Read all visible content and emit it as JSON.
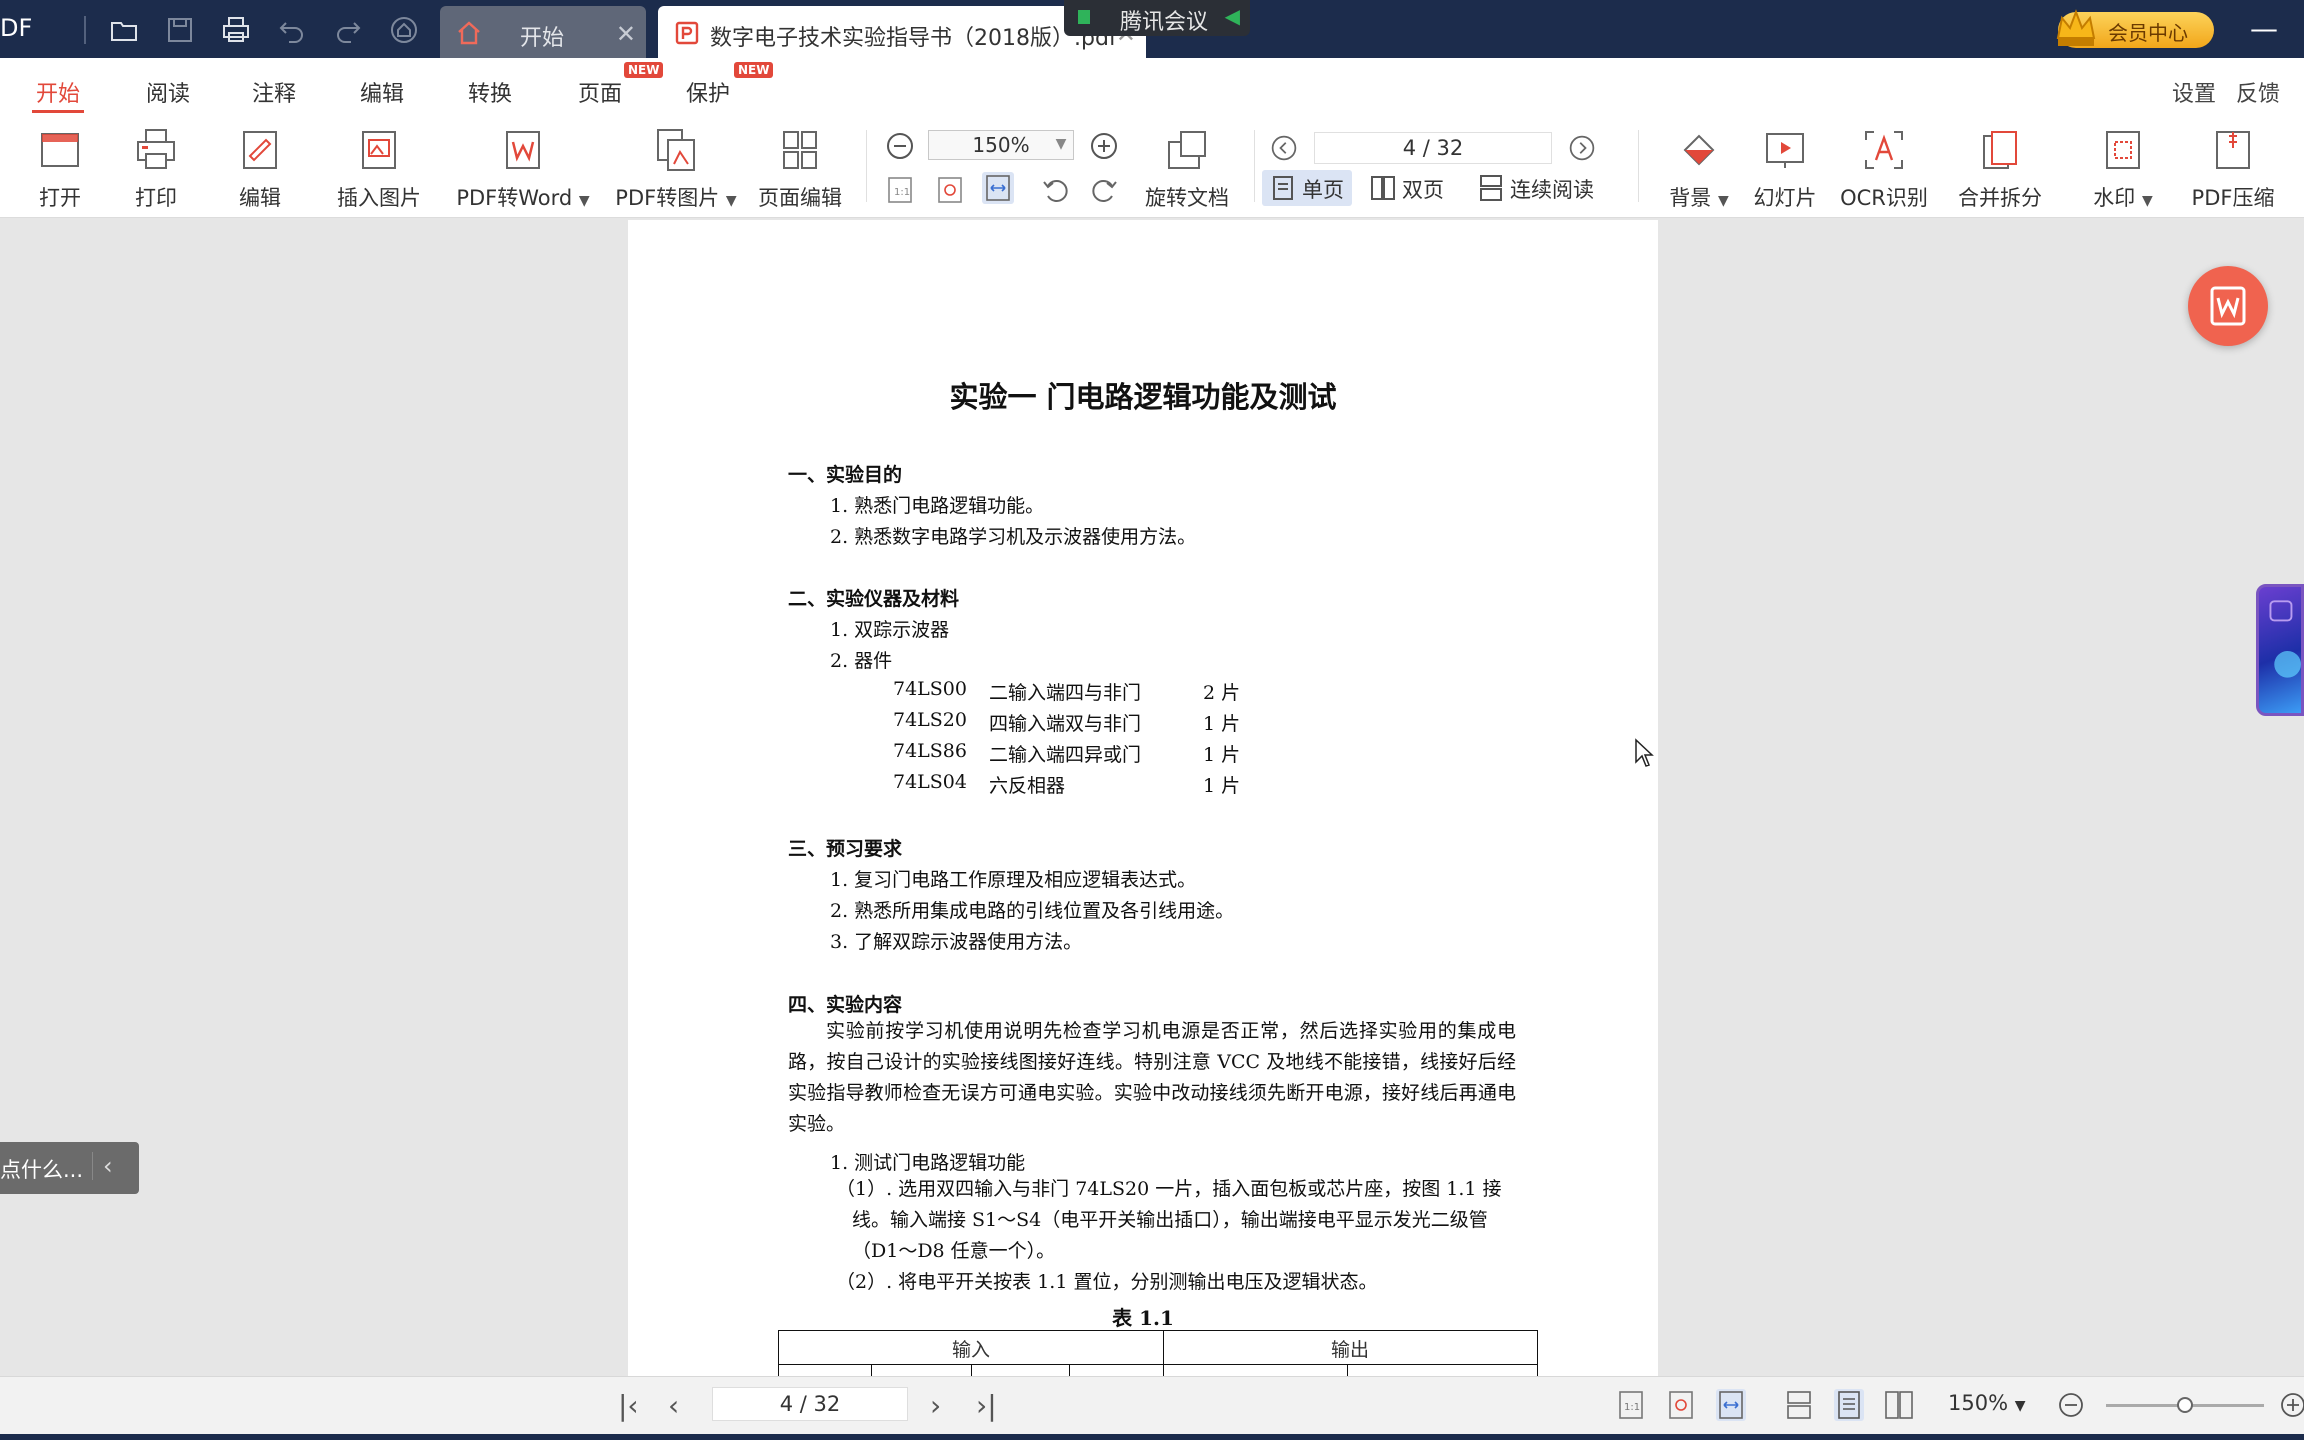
{
  "titlebar": {
    "app_fragment": "DF",
    "tabs": [
      {
        "label": "开始"
      },
      {
        "label": "数字电子技术实验指导书（2018版）.pdf"
      }
    ],
    "meeting_label": "腾讯会议",
    "vip_label": "会员中心",
    "minimize": "—"
  },
  "menu": {
    "items": [
      {
        "label": "开始",
        "active": true
      },
      {
        "label": "阅读"
      },
      {
        "label": "注释"
      },
      {
        "label": "编辑"
      },
      {
        "label": "转换"
      },
      {
        "label": "页面",
        "badge": "NEW"
      },
      {
        "label": "保护",
        "badge": "NEW"
      }
    ],
    "right": [
      "设置",
      "反馈"
    ]
  },
  "toolbar": {
    "open": "打开",
    "print": "打印",
    "edit": "编辑",
    "insert_image": "插入图片",
    "pdf_to_word": "PDF转Word",
    "pdf_to_image": "PDF转图片",
    "page_edit": "页面编辑",
    "zoom": "150%",
    "rotate_doc": "旋转文档",
    "page_indicator": "4 / 32",
    "single": "单页",
    "double": "双页",
    "continuous": "连续阅读",
    "background": "背景",
    "slideshow": "幻灯片",
    "ocr": "OCR识别",
    "merge_split": "合并拆分",
    "watermark": "水印",
    "compress": "PDF压缩"
  },
  "document": {
    "title": "实验一  门电路逻辑功能及测试",
    "s1": {
      "heading": "一、实验目的",
      "items": [
        "1. 熟悉门电路逻辑功能。",
        "2. 熟悉数字电路学习机及示波器使用方法。"
      ]
    },
    "s2": {
      "heading": "二、实验仪器及材料",
      "items": [
        "1. 双踪示波器",
        "2. 器件"
      ],
      "components": [
        {
          "part": "74LS00",
          "desc": "二输入端四与非门",
          "qty": "2 片"
        },
        {
          "part": "74LS20",
          "desc": "四输入端双与非门",
          "qty": "1 片"
        },
        {
          "part": "74LS86",
          "desc": "二输入端四异或门",
          "qty": "1 片"
        },
        {
          "part": "74LS04",
          "desc": "六反相器",
          "qty": "1 片"
        }
      ]
    },
    "s3": {
      "heading": "三、预习要求",
      "items": [
        "1. 复习门电路工作原理及相应逻辑表达式。",
        "2. 熟悉所用集成电路的引线位置及各引线用途。",
        "3. 了解双踪示波器使用方法。"
      ]
    },
    "s4": {
      "heading": "四、实验内容",
      "paragraph": "实验前按学习机使用说明先检查学习机电源是否正常，然后选择实验用的集成电路，按自己设计的实验接线图接好连线。特别注意 VCC 及地线不能接错，线接好后经实验指导教师检查无误方可通电实验。实验中改动接线须先断开电源，接好线后再通电实验。",
      "item1": "1. 测试门电路逻辑功能",
      "step1": "（1）. 选用双四输入与非门 74LS20 一片，插入面包板或芯片座，按图 1.1 接线。输入端接 S1～S4（电平开关输出插口），输出端接电平显示发光二级管（D1～D8 任意一个）。",
      "step2": "（2）. 将电平开关按表 1.1 置位，分别测输出电压及逻辑状态。",
      "table_caption": "表 1.1",
      "table_headers": [
        "输入",
        "输出"
      ]
    }
  },
  "side": {
    "ask_text": "点什么...",
    "ask_chevron": "‹"
  },
  "status": {
    "page": "4 / 32",
    "zoom": "150%",
    "zoom_level": 0.5
  }
}
